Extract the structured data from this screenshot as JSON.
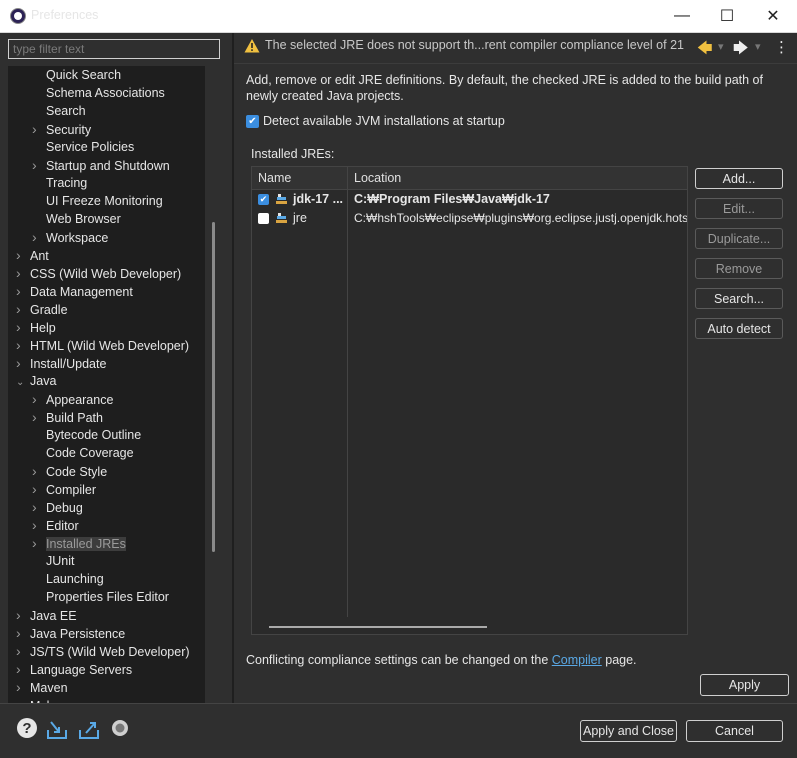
{
  "window": {
    "title": "Preferences",
    "minimize": "—",
    "maximize": "☐",
    "close": "✕"
  },
  "filter": {
    "placeholder": "type filter text",
    "value": ""
  },
  "tree": [
    {
      "label": "Quick Search",
      "level": 2,
      "chevron": ""
    },
    {
      "label": "Schema Associations",
      "level": 2,
      "chevron": ""
    },
    {
      "label": "Search",
      "level": 2,
      "chevron": ""
    },
    {
      "label": "Security",
      "level": 2,
      "chevron": ">"
    },
    {
      "label": "Service Policies",
      "level": 2,
      "chevron": ""
    },
    {
      "label": "Startup and Shutdown",
      "level": 2,
      "chevron": ">"
    },
    {
      "label": "Tracing",
      "level": 2,
      "chevron": ""
    },
    {
      "label": "UI Freeze Monitoring",
      "level": 2,
      "chevron": ""
    },
    {
      "label": "Web Browser",
      "level": 2,
      "chevron": ""
    },
    {
      "label": "Workspace",
      "level": 2,
      "chevron": ">"
    },
    {
      "label": "Ant",
      "level": 1,
      "chevron": ">"
    },
    {
      "label": "CSS (Wild Web Developer)",
      "level": 1,
      "chevron": ">"
    },
    {
      "label": "Data Management",
      "level": 1,
      "chevron": ">"
    },
    {
      "label": "Gradle",
      "level": 1,
      "chevron": ">"
    },
    {
      "label": "Help",
      "level": 1,
      "chevron": ">"
    },
    {
      "label": "HTML (Wild Web Developer)",
      "level": 1,
      "chevron": ">"
    },
    {
      "label": "Install/Update",
      "level": 1,
      "chevron": ">"
    },
    {
      "label": "Java",
      "level": 1,
      "chevron": "v"
    },
    {
      "label": "Appearance",
      "level": 2,
      "chevron": ">"
    },
    {
      "label": "Build Path",
      "level": 2,
      "chevron": ">"
    },
    {
      "label": "Bytecode Outline",
      "level": 2,
      "chevron": ""
    },
    {
      "label": "Code Coverage",
      "level": 2,
      "chevron": ""
    },
    {
      "label": "Code Style",
      "level": 2,
      "chevron": ">"
    },
    {
      "label": "Compiler",
      "level": 2,
      "chevron": ">"
    },
    {
      "label": "Debug",
      "level": 2,
      "chevron": ">"
    },
    {
      "label": "Editor",
      "level": 2,
      "chevron": ">"
    },
    {
      "label": "Installed JREs",
      "level": 2,
      "chevron": ">",
      "selected": true
    },
    {
      "label": "JUnit",
      "level": 2,
      "chevron": ""
    },
    {
      "label": "Launching",
      "level": 2,
      "chevron": ""
    },
    {
      "label": "Properties Files Editor",
      "level": 2,
      "chevron": ""
    },
    {
      "label": "Java EE",
      "level": 1,
      "chevron": ">"
    },
    {
      "label": "Java Persistence",
      "level": 1,
      "chevron": ">"
    },
    {
      "label": "JS/TS (Wild Web Developer)",
      "level": 1,
      "chevron": ">"
    },
    {
      "label": "Language Servers",
      "level": 1,
      "chevron": ">"
    },
    {
      "label": "Maven",
      "level": 1,
      "chevron": ">"
    },
    {
      "label": "Mylyn",
      "level": 1,
      "chevron": ">"
    }
  ],
  "header": {
    "warning": "The selected JRE does not support th...rent compiler compliance level of 21",
    "back": "🡄",
    "forward": "🡆",
    "dropdown": "▾",
    "menu": "⋮"
  },
  "page": {
    "description": "Add, remove or edit JRE definitions. By default, the checked JRE is added to the build path of newly created Java projects.",
    "detect_label": "Detect available JVM installations at startup",
    "detect_checked": true,
    "installed_label": "Installed JREs:",
    "columns": {
      "name": "Name",
      "location": "Location"
    },
    "jres": [
      {
        "name": "jdk-17 ...",
        "location": "C:₩Program Files₩Java₩jdk-17",
        "checked": true,
        "bold": true
      },
      {
        "name": "jre",
        "location": "C:₩hshTools₩eclipse₩plugins₩org.eclipse.justj.openjdk.hotspo",
        "checked": false,
        "bold": false
      }
    ],
    "buttons": {
      "add": "Add...",
      "edit": "Edit...",
      "duplicate": "Duplicate...",
      "remove": "Remove",
      "search": "Search...",
      "auto_detect": "Auto detect"
    },
    "conflict_prefix": "Conflicting compliance settings can be changed on the ",
    "conflict_link": "Compiler",
    "conflict_suffix": " page.",
    "apply": "Apply"
  },
  "footer": {
    "apply_close": "Apply and Close",
    "cancel": "Cancel",
    "help_icon": "?",
    "import_icon": "import-icon",
    "export_icon": "export-icon",
    "record_icon": "record-icon"
  },
  "colors": {
    "accent": "#3b8ee0",
    "link": "#5aa9e6",
    "warning": "#f0c040",
    "background": "#2f2f2f",
    "tree_bg": "#1e1e1e"
  }
}
